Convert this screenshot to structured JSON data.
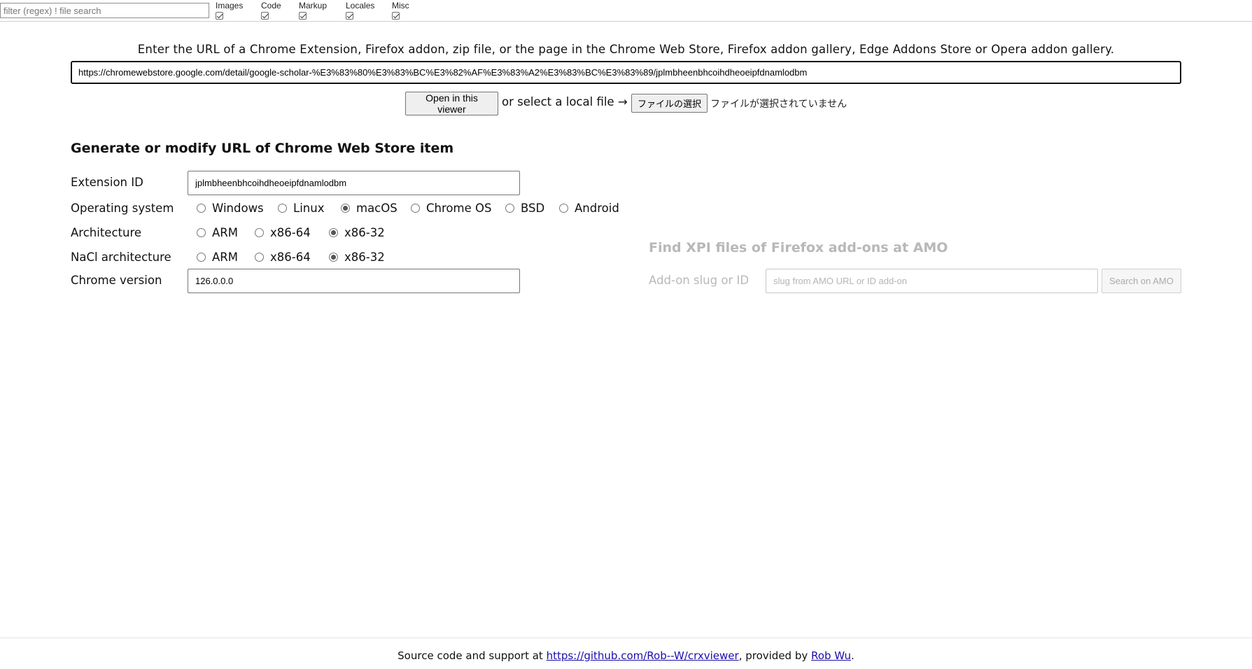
{
  "filter_bar": {
    "search_placeholder": "filter (regex) ! file search",
    "categories": [
      {
        "label": "Images",
        "checked": true
      },
      {
        "label": "Code",
        "checked": true
      },
      {
        "label": "Markup",
        "checked": true
      },
      {
        "label": "Locales",
        "checked": true
      },
      {
        "label": "Misc",
        "checked": true
      }
    ]
  },
  "open_section": {
    "prompt": "Enter the URL of a Chrome Extension, Firefox addon, zip file, or the page in the Chrome Web Store, Firefox addon gallery, Edge Addons Store or Opera addon gallery.",
    "url_value": "https://chromewebstore.google.com/detail/google-scholar-%E3%83%80%E3%83%BC%E3%82%AF%E3%83%A2%E3%83%BC%E3%83%89/jplmbheenbhcoihdheoeipfdnamlodbm",
    "open_button": "Open in this viewer",
    "local_file_text": "or select a local file →",
    "file_button": "ファイルの選択",
    "file_status": "ファイルが選択されていません"
  },
  "cws_form": {
    "title": "Generate or modify URL of Chrome Web Store item",
    "extension_id_label": "Extension ID",
    "extension_id_value": "jplmbheenbhcoihdheoeipfdnamlodbm",
    "os_label": "Operating system",
    "os_options": [
      "Windows",
      "Linux",
      "macOS",
      "Chrome OS",
      "BSD",
      "Android"
    ],
    "os_selected": "macOS",
    "arch_label": "Architecture",
    "arch_options": [
      "ARM",
      "x86-64",
      "x86-32"
    ],
    "arch_selected": "x86-32",
    "nacl_label": "NaCl architecture",
    "nacl_options": [
      "ARM",
      "x86-64",
      "x86-32"
    ],
    "nacl_selected": "x86-32",
    "chrome_version_label": "Chrome version",
    "chrome_version_value": "126.0.0.0"
  },
  "amo_form": {
    "title": "Find XPI files of Firefox add-ons at AMO",
    "slug_label": "Add-on slug or ID",
    "slug_placeholder": "slug from AMO URL or ID add-on",
    "search_button": "Search on AMO"
  },
  "footer": {
    "prefix": "Source code and support at ",
    "repo_link": "https://github.com/Rob--W/crxviewer",
    "middle": ", provided by ",
    "author_link": "Rob Wu",
    "suffix": "."
  }
}
